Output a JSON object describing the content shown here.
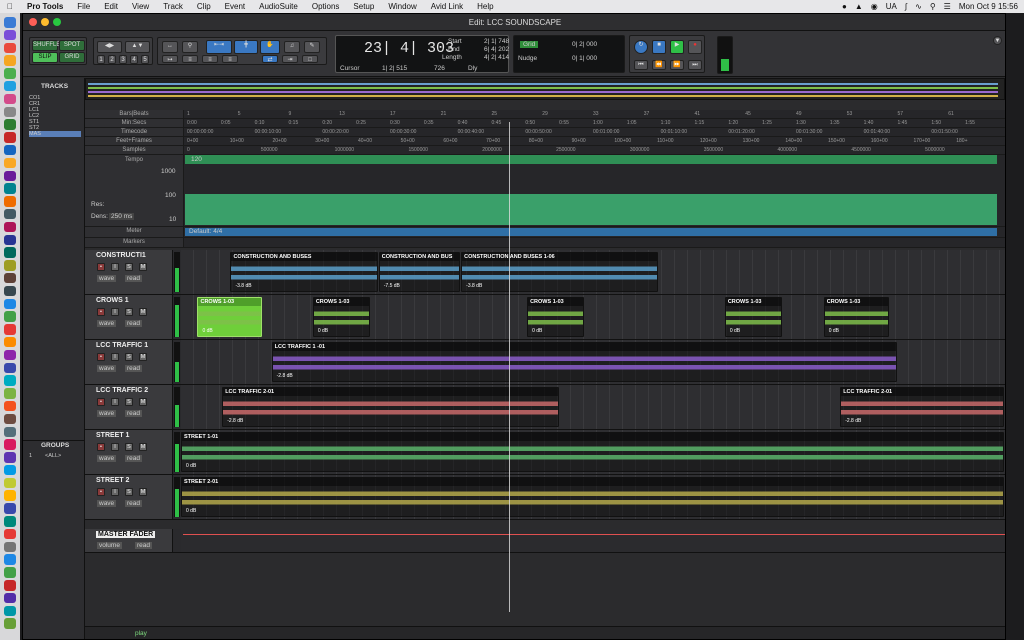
{
  "menubar": {
    "app": "Pro Tools",
    "items": [
      "File",
      "Edit",
      "View",
      "Track",
      "Clip",
      "Event",
      "AudioSuite",
      "Options",
      "Setup",
      "Window",
      "Avid Link",
      "Help"
    ],
    "status_ua": "UA",
    "clock": "Mon Oct 9  15:56"
  },
  "window": {
    "title": "Edit: LCC SOUNDSCAPE"
  },
  "toolbar": {
    "modes": [
      "SHUFFLE",
      "SPOT",
      "SLIP",
      "GRID"
    ],
    "zoom_presets": [
      "1",
      "2",
      "3",
      "4",
      "5"
    ],
    "main_counter": "23| 4| 303",
    "cursor_label": "Cursor",
    "cursor_value": "1| 2| 515",
    "cursor_extra": "726",
    "dly_label": "Dly",
    "start_label": "Start",
    "start_value": "2| 1| 748",
    "end_label": "End",
    "end_value": "6| 4| 202",
    "length_label": "Length",
    "length_value": "4| 2| 414",
    "grid_label": "Grid",
    "grid_value": "0| 2| 000",
    "nudge_label": "Nudge",
    "nudge_value": "0| 1| 000"
  },
  "left": {
    "tracks_header": "TRACKS",
    "tracks": [
      "CO1",
      "CR1",
      "LC1",
      "LC2",
      "ST1",
      "ST2",
      "MAS"
    ],
    "groups_header": "GROUPS",
    "group_id": "1",
    "group_name": "<ALL>"
  },
  "rulers": {
    "rows": [
      {
        "name": "Bars|Beats",
        "ticks": [
          "1",
          "5",
          "9",
          "13",
          "17",
          "21",
          "25",
          "29",
          "33",
          "37",
          "41",
          "45",
          "49",
          "53",
          "57",
          "61"
        ]
      },
      {
        "name": "Min:Secs",
        "ticks": [
          "0:00",
          "0:05",
          "0:10",
          "0:15",
          "0:20",
          "0:25",
          "0:30",
          "0:35",
          "0:40",
          "0:45",
          "0:50",
          "0:55",
          "1:00",
          "1:05",
          "1:10",
          "1:15",
          "1:20",
          "1:25",
          "1:30",
          "1:35",
          "1:40",
          "1:45",
          "1:50",
          "1:55"
        ]
      },
      {
        "name": "Timecode",
        "ticks": [
          "00:00:00:00",
          "00:00:10:00",
          "00:00:20:00",
          "00:00:30:00",
          "00:00:40:00",
          "00:00:50:00",
          "00:01:00:00",
          "00:01:10:00",
          "00:01:20:00",
          "00:01:30:00",
          "00:01:40:00",
          "00:01:50:00"
        ]
      },
      {
        "name": "Feet+Frames",
        "ticks": [
          "0+00",
          "10+00",
          "20+00",
          "30+00",
          "40+00",
          "50+00",
          "60+00",
          "70+00",
          "80+00",
          "90+00",
          "100+00",
          "110+00",
          "120+00",
          "130+00",
          "140+00",
          "150+00",
          "160+00",
          "170+00",
          "180+"
        ]
      },
      {
        "name": "Samples",
        "ticks": [
          "0",
          "500000",
          "1000000",
          "1500000",
          "2000000",
          "2500000",
          "3000000",
          "3500000",
          "4000000",
          "4500000",
          "5000000"
        ]
      }
    ],
    "tempo_label": "Tempo",
    "tempo_value": "120",
    "tempo_scale": [
      "1000",
      "100",
      "10"
    ],
    "res_label": "Res:",
    "dens_label": "Dens:",
    "dens_value": "250 ms",
    "meter_label": "Meter",
    "meter_value": "Default: 4/4",
    "markers_label": "Markers"
  },
  "tracks": [
    {
      "name": "CONSTRUCTI1",
      "color": "#5a9ec9",
      "meter": 0.6,
      "clips": [
        {
          "name": "CONSTRUCTION AND BUSES",
          "gain": "-3.8 dB",
          "start": 0.06,
          "end": 0.24
        },
        {
          "name": "CONSTRUCTION AND BUS",
          "gain": "-7.5 dB",
          "start": 0.24,
          "end": 0.34
        },
        {
          "name": "CONSTRUCTION AND BUSES 1-06",
          "gain": "-3.8 dB",
          "start": 0.34,
          "end": 0.58
        }
      ]
    },
    {
      "name": "CROWS 1",
      "color": "#7fbf4a",
      "meter": 0.8,
      "clips": [
        {
          "name": "CROWS 1-03",
          "gain": "0 dB",
          "start": 0.02,
          "end": 0.1,
          "selected": true
        },
        {
          "name": "CROWS 1-03",
          "gain": "0 dB",
          "start": 0.16,
          "end": 0.23
        },
        {
          "name": "CROWS 1-03",
          "gain": "0 dB",
          "start": 0.42,
          "end": 0.49
        },
        {
          "name": "CROWS 1-03",
          "gain": "0 dB",
          "start": 0.66,
          "end": 0.73
        },
        {
          "name": "CROWS 1-03",
          "gain": "0 dB",
          "start": 0.78,
          "end": 0.86
        }
      ]
    },
    {
      "name": "LCC TRAFFIC 1",
      "color": "#8a5cc9",
      "meter": 0.5,
      "clips": [
        {
          "name": "LCC TRAFFIC 1 -01",
          "gain": "-2.8 dB",
          "start": 0.11,
          "end": 0.87
        }
      ]
    },
    {
      "name": "LCC TRAFFIC 2",
      "color": "#c96a6a",
      "meter": 0.55,
      "clips": [
        {
          "name": "LCC TRAFFIC 2-01",
          "gain": "-2.8 dB",
          "start": 0.05,
          "end": 0.46
        },
        {
          "name": "LCC TRAFFIC 2-01",
          "gain": "-2.8 dB",
          "start": 0.8,
          "end": 1.0
        }
      ]
    },
    {
      "name": "STREET 1",
      "color": "#5ab36a",
      "meter": 0.7,
      "clips": [
        {
          "name": "STREET 1-01",
          "gain": "0 dB",
          "start": 0.0,
          "end": 1.0
        }
      ]
    },
    {
      "name": "STREET 2",
      "color": "#b3a84a",
      "meter": 0.7,
      "clips": [
        {
          "name": "STREET 2-01",
          "gain": "0 dB",
          "start": 0.0,
          "end": 1.0
        }
      ]
    }
  ],
  "master": {
    "name": "MASTER FADER",
    "volume_label": "volume",
    "read_label": "read"
  },
  "track_controls": {
    "rec": "•",
    "input": "I",
    "solo": "S",
    "mute": "M",
    "view": "wave",
    "read": "read"
  },
  "bottom": {
    "status": "play"
  }
}
